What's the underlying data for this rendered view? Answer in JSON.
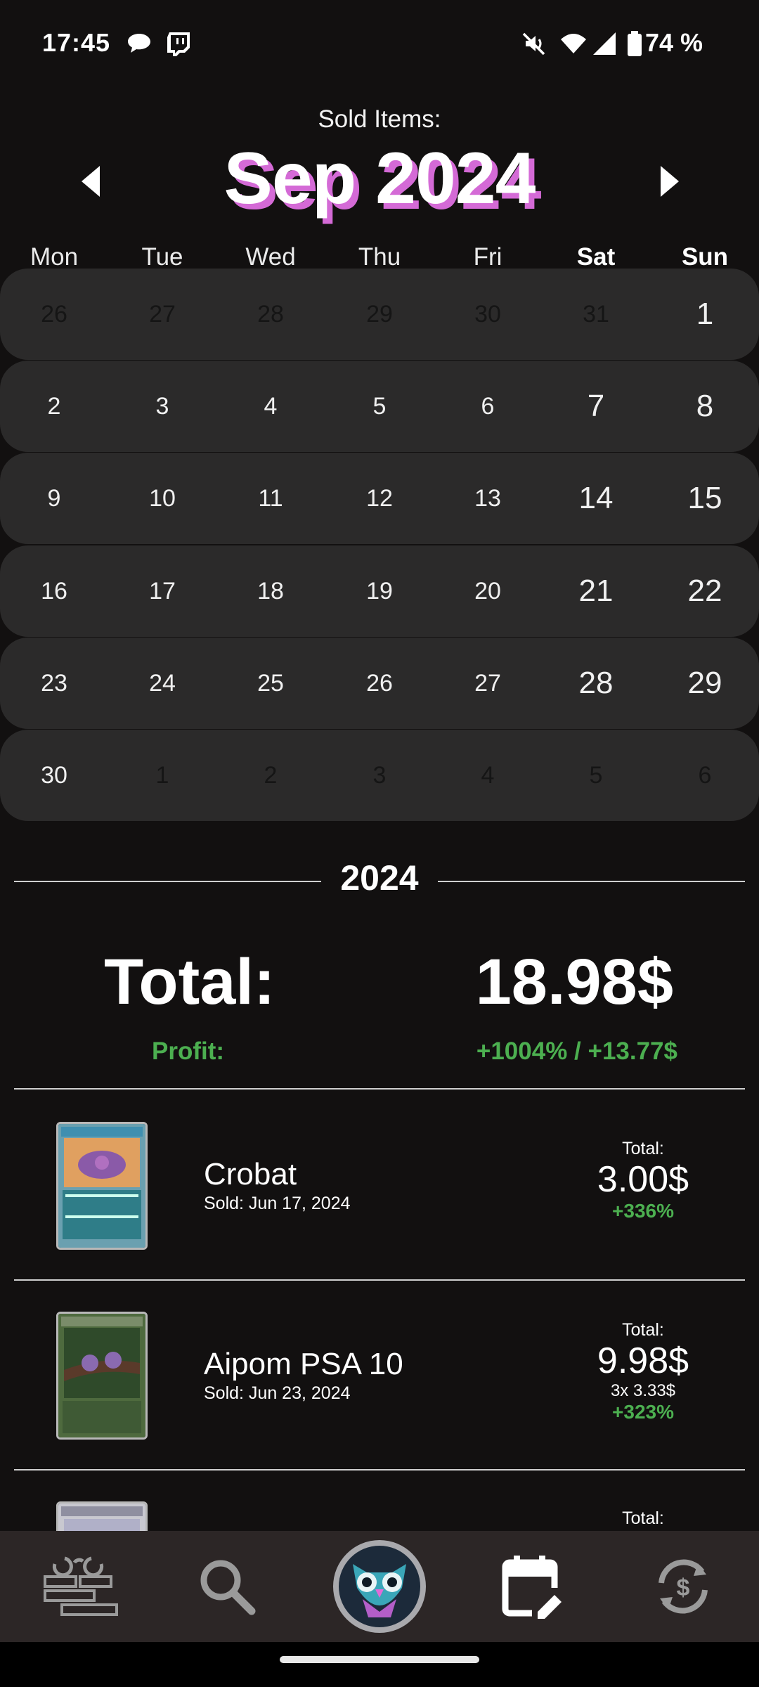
{
  "status_bar": {
    "time": "17:45",
    "battery_percent": "74 %"
  },
  "header": {
    "subtitle": "Sold Items:",
    "month": "Sep 2024"
  },
  "weekdays": [
    "Mon",
    "Tue",
    "Wed",
    "Thu",
    "Fri",
    "Sat",
    "Sun"
  ],
  "calendar": [
    [
      {
        "d": "26",
        "m": true
      },
      {
        "d": "27",
        "m": true
      },
      {
        "d": "28",
        "m": true
      },
      {
        "d": "29",
        "m": true
      },
      {
        "d": "30",
        "m": true
      },
      {
        "d": "31",
        "m": true
      },
      {
        "d": "1",
        "b": true
      }
    ],
    [
      {
        "d": "2"
      },
      {
        "d": "3"
      },
      {
        "d": "4"
      },
      {
        "d": "5"
      },
      {
        "d": "6"
      },
      {
        "d": "7",
        "b": true
      },
      {
        "d": "8",
        "b": true
      }
    ],
    [
      {
        "d": "9"
      },
      {
        "d": "10"
      },
      {
        "d": "11"
      },
      {
        "d": "12"
      },
      {
        "d": "13"
      },
      {
        "d": "14",
        "b": true
      },
      {
        "d": "15",
        "b": true
      }
    ],
    [
      {
        "d": "16"
      },
      {
        "d": "17"
      },
      {
        "d": "18"
      },
      {
        "d": "19"
      },
      {
        "d": "20"
      },
      {
        "d": "21",
        "b": true
      },
      {
        "d": "22",
        "b": true
      }
    ],
    [
      {
        "d": "23"
      },
      {
        "d": "24"
      },
      {
        "d": "25"
      },
      {
        "d": "26"
      },
      {
        "d": "27"
      },
      {
        "d": "28",
        "b": true
      },
      {
        "d": "29",
        "b": true
      }
    ],
    [
      {
        "d": "30"
      },
      {
        "d": "1",
        "m": true
      },
      {
        "d": "2",
        "m": true
      },
      {
        "d": "3",
        "m": true
      },
      {
        "d": "4",
        "m": true
      },
      {
        "d": "5",
        "m": true
      },
      {
        "d": "6",
        "m": true
      }
    ]
  ],
  "year": "2024",
  "summary": {
    "total_label": "Total:",
    "total_value": "18.98$",
    "profit_label": "Profit:",
    "profit_value": "+1004% / +13.77$"
  },
  "items": [
    {
      "name": "Crobat",
      "sold": "Sold: Jun 17, 2024",
      "total_label": "Total:",
      "total": "3.00$",
      "qty": "",
      "pct": "+336%"
    },
    {
      "name": "Aipom PSA 10",
      "sold": "Sold: Jun 23, 2024",
      "total_label": "Total:",
      "total": "9.98$",
      "qty": "3x 3.33$",
      "pct": "+323%"
    },
    {
      "name": "",
      "sold": "",
      "total_label": "Total:",
      "total": "",
      "qty": "",
      "pct": ""
    }
  ],
  "colors": {
    "background": "#121010",
    "calendar_row": "#2b2a2a",
    "accent_pink": "#d46ad6",
    "profit_green": "#4caf50",
    "nav_bg": "#2c2626"
  },
  "nav": {
    "items": [
      "collection-icon",
      "search-icon",
      "owl-logo",
      "calendar-edit-icon",
      "currency-sync-icon"
    ]
  }
}
